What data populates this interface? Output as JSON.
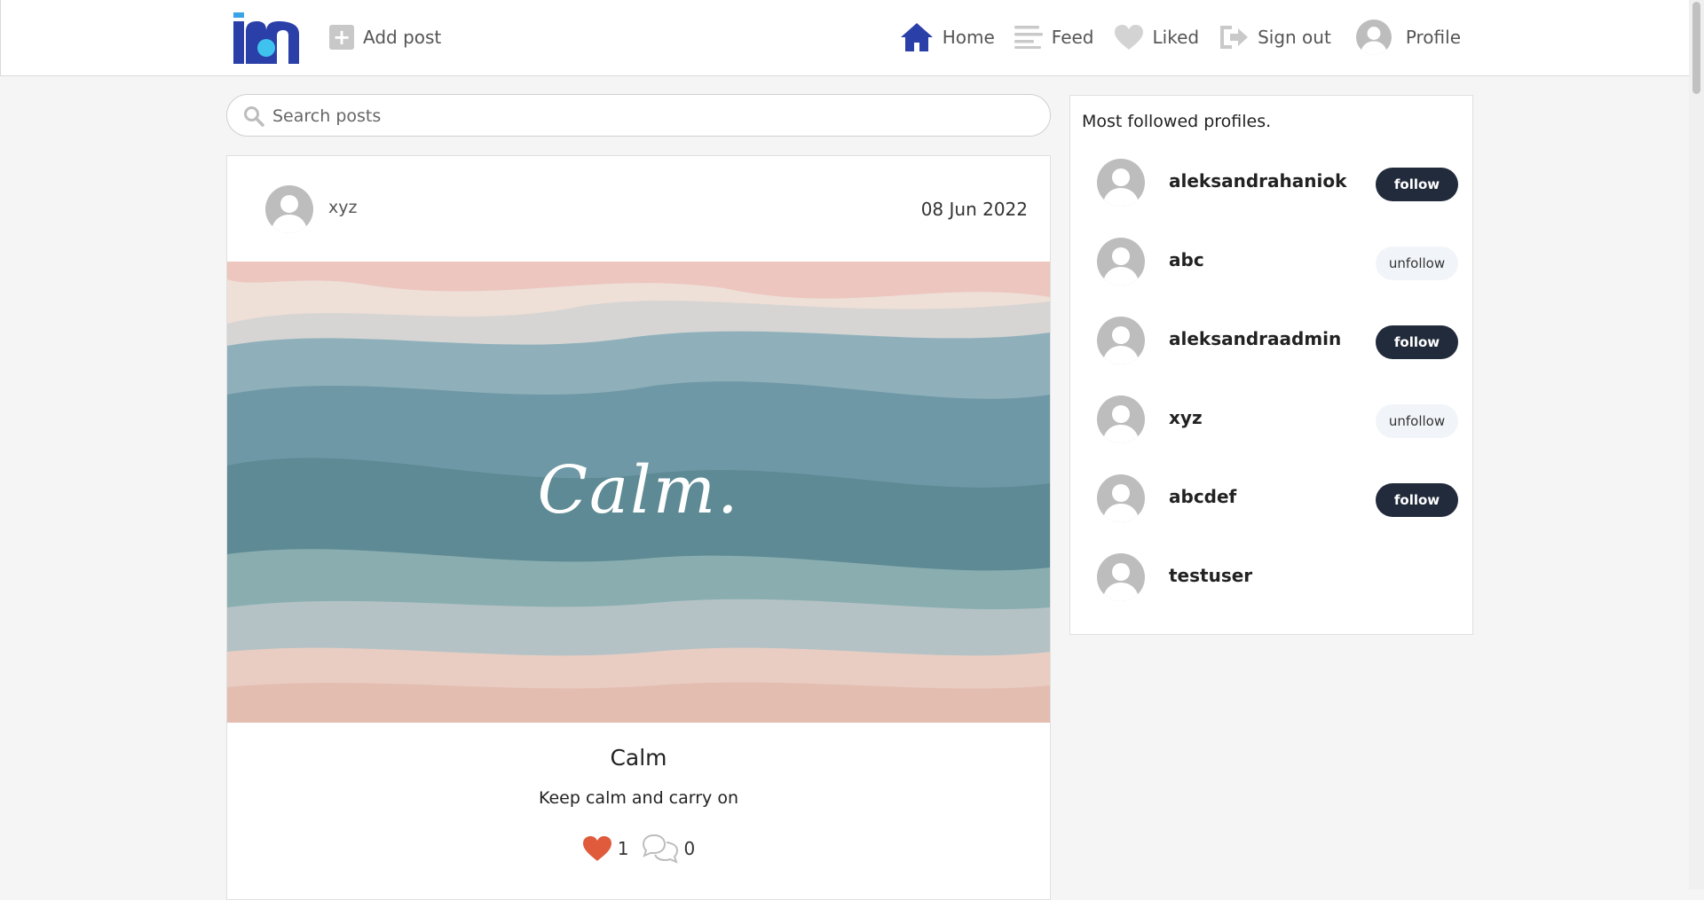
{
  "nav": {
    "add_post": "Add post",
    "home": "Home",
    "feed": "Feed",
    "liked": "Liked",
    "sign_out": "Sign out",
    "profile": "Profile",
    "home_color": "#2b3fa8"
  },
  "search": {
    "placeholder": "Search posts"
  },
  "post": {
    "author": "xyz",
    "date": "08 Jun 2022",
    "image_text": "Calm.",
    "title": "Calm",
    "description": "Keep calm and carry on",
    "likes": "1",
    "comments": "0",
    "heart_color": "#e05a3c"
  },
  "sidebar": {
    "title": "Most followed profiles.",
    "profiles": [
      {
        "name": "aleksandrahaniok",
        "button": "follow",
        "style": "dark"
      },
      {
        "name": "abc",
        "button": "unfollow",
        "style": "light"
      },
      {
        "name": "aleksandraadmin",
        "button": "follow",
        "style": "dark"
      },
      {
        "name": "xyz",
        "button": "unfollow",
        "style": "light"
      },
      {
        "name": "abcdef",
        "button": "follow",
        "style": "dark"
      },
      {
        "name": "testuser",
        "button": "",
        "style": "none"
      }
    ]
  }
}
